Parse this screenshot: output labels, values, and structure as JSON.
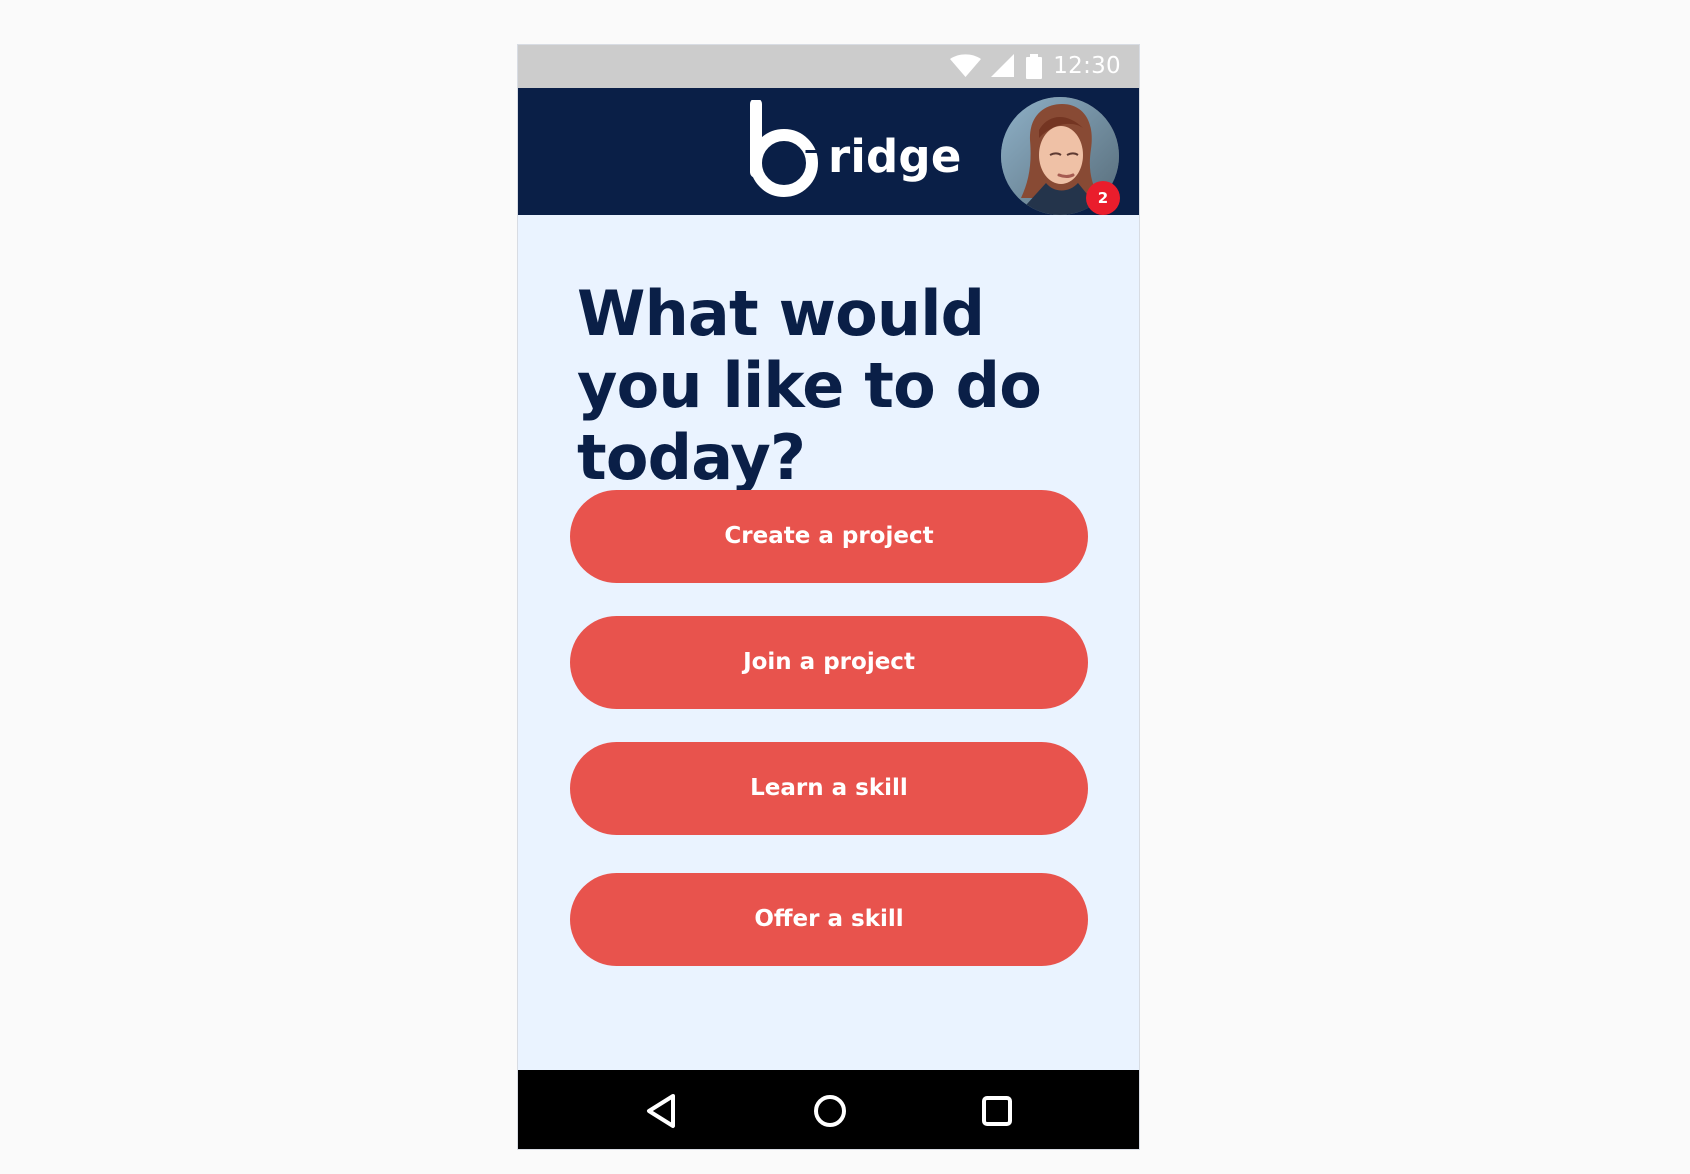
{
  "status_bar": {
    "time": "12:30",
    "wifi_icon": "wifi-icon",
    "signal_icon": "signal-icon",
    "battery_icon": "battery-icon",
    "icon_color": "#ffffff"
  },
  "header": {
    "logo_text": "ridge",
    "brand_color": "#0a1f47"
  },
  "profile": {
    "notification_count": "2",
    "badge_color": "#ea1d2c"
  },
  "main": {
    "title": "What would you like to do today?",
    "actions": [
      {
        "label": "Create a project"
      },
      {
        "label": "Join a project"
      },
      {
        "label": "Learn a skill"
      },
      {
        "label": "Offer a skill"
      }
    ],
    "button_color": "#e8534d",
    "background_color": "#eaf3ff"
  },
  "navigation": {
    "back_icon": "back-icon",
    "home_icon": "home-icon",
    "recent_apps_icon": "recent-apps-icon"
  }
}
